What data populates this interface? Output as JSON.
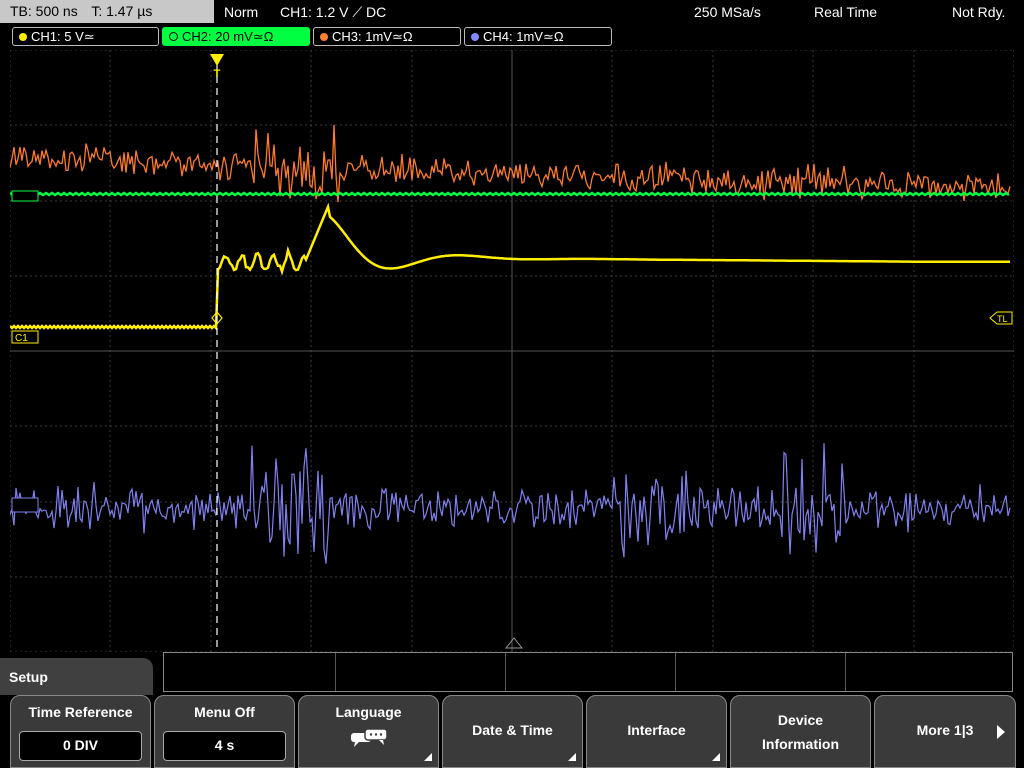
{
  "status": {
    "timebase": "TB: 500 ns",
    "trigger_time": "T: 1.47 µs",
    "trigger_mode": "Norm",
    "trigger_source": "CH1: 1.2 V ⟋ DC",
    "sample_rate": "250 MSa/s",
    "acquisition_mode": "Real Time",
    "state": "Not Rdy."
  },
  "channels": [
    {
      "label": "CH1: 5 V≃",
      "color": "#ffee00",
      "active": false
    },
    {
      "label": "CH2: 20 mV≃Ω",
      "color": "#00ff40",
      "active": true
    },
    {
      "label": "CH3: 1mV≃Ω",
      "color": "#ff8030",
      "active": false
    },
    {
      "label": "CH4: 1mV≃Ω",
      "color": "#8888ff",
      "active": false
    }
  ],
  "markers": {
    "ch1": "C1",
    "trigger_level": "TL",
    "trigger_pos": "T"
  },
  "colors": {
    "ch1": "#ffee00",
    "ch2": "#00ff40",
    "ch3": "#ff7a2a",
    "ch4": "#8080f0",
    "grid": "#3c3c3c",
    "softkey_bg": "#3a3a3a"
  },
  "menu": {
    "title": "Setup",
    "softkeys": [
      {
        "title": "Time Reference",
        "value": "0 DIV"
      },
      {
        "title": "Menu Off",
        "value": "4 s"
      },
      {
        "title": "Language",
        "icon": "speech-bubble-icon"
      },
      {
        "title": "Date & Time"
      },
      {
        "title": "Interface"
      },
      {
        "title_line1": "Device",
        "title_line2": "Information"
      },
      {
        "title": "More 1|3"
      }
    ]
  }
}
